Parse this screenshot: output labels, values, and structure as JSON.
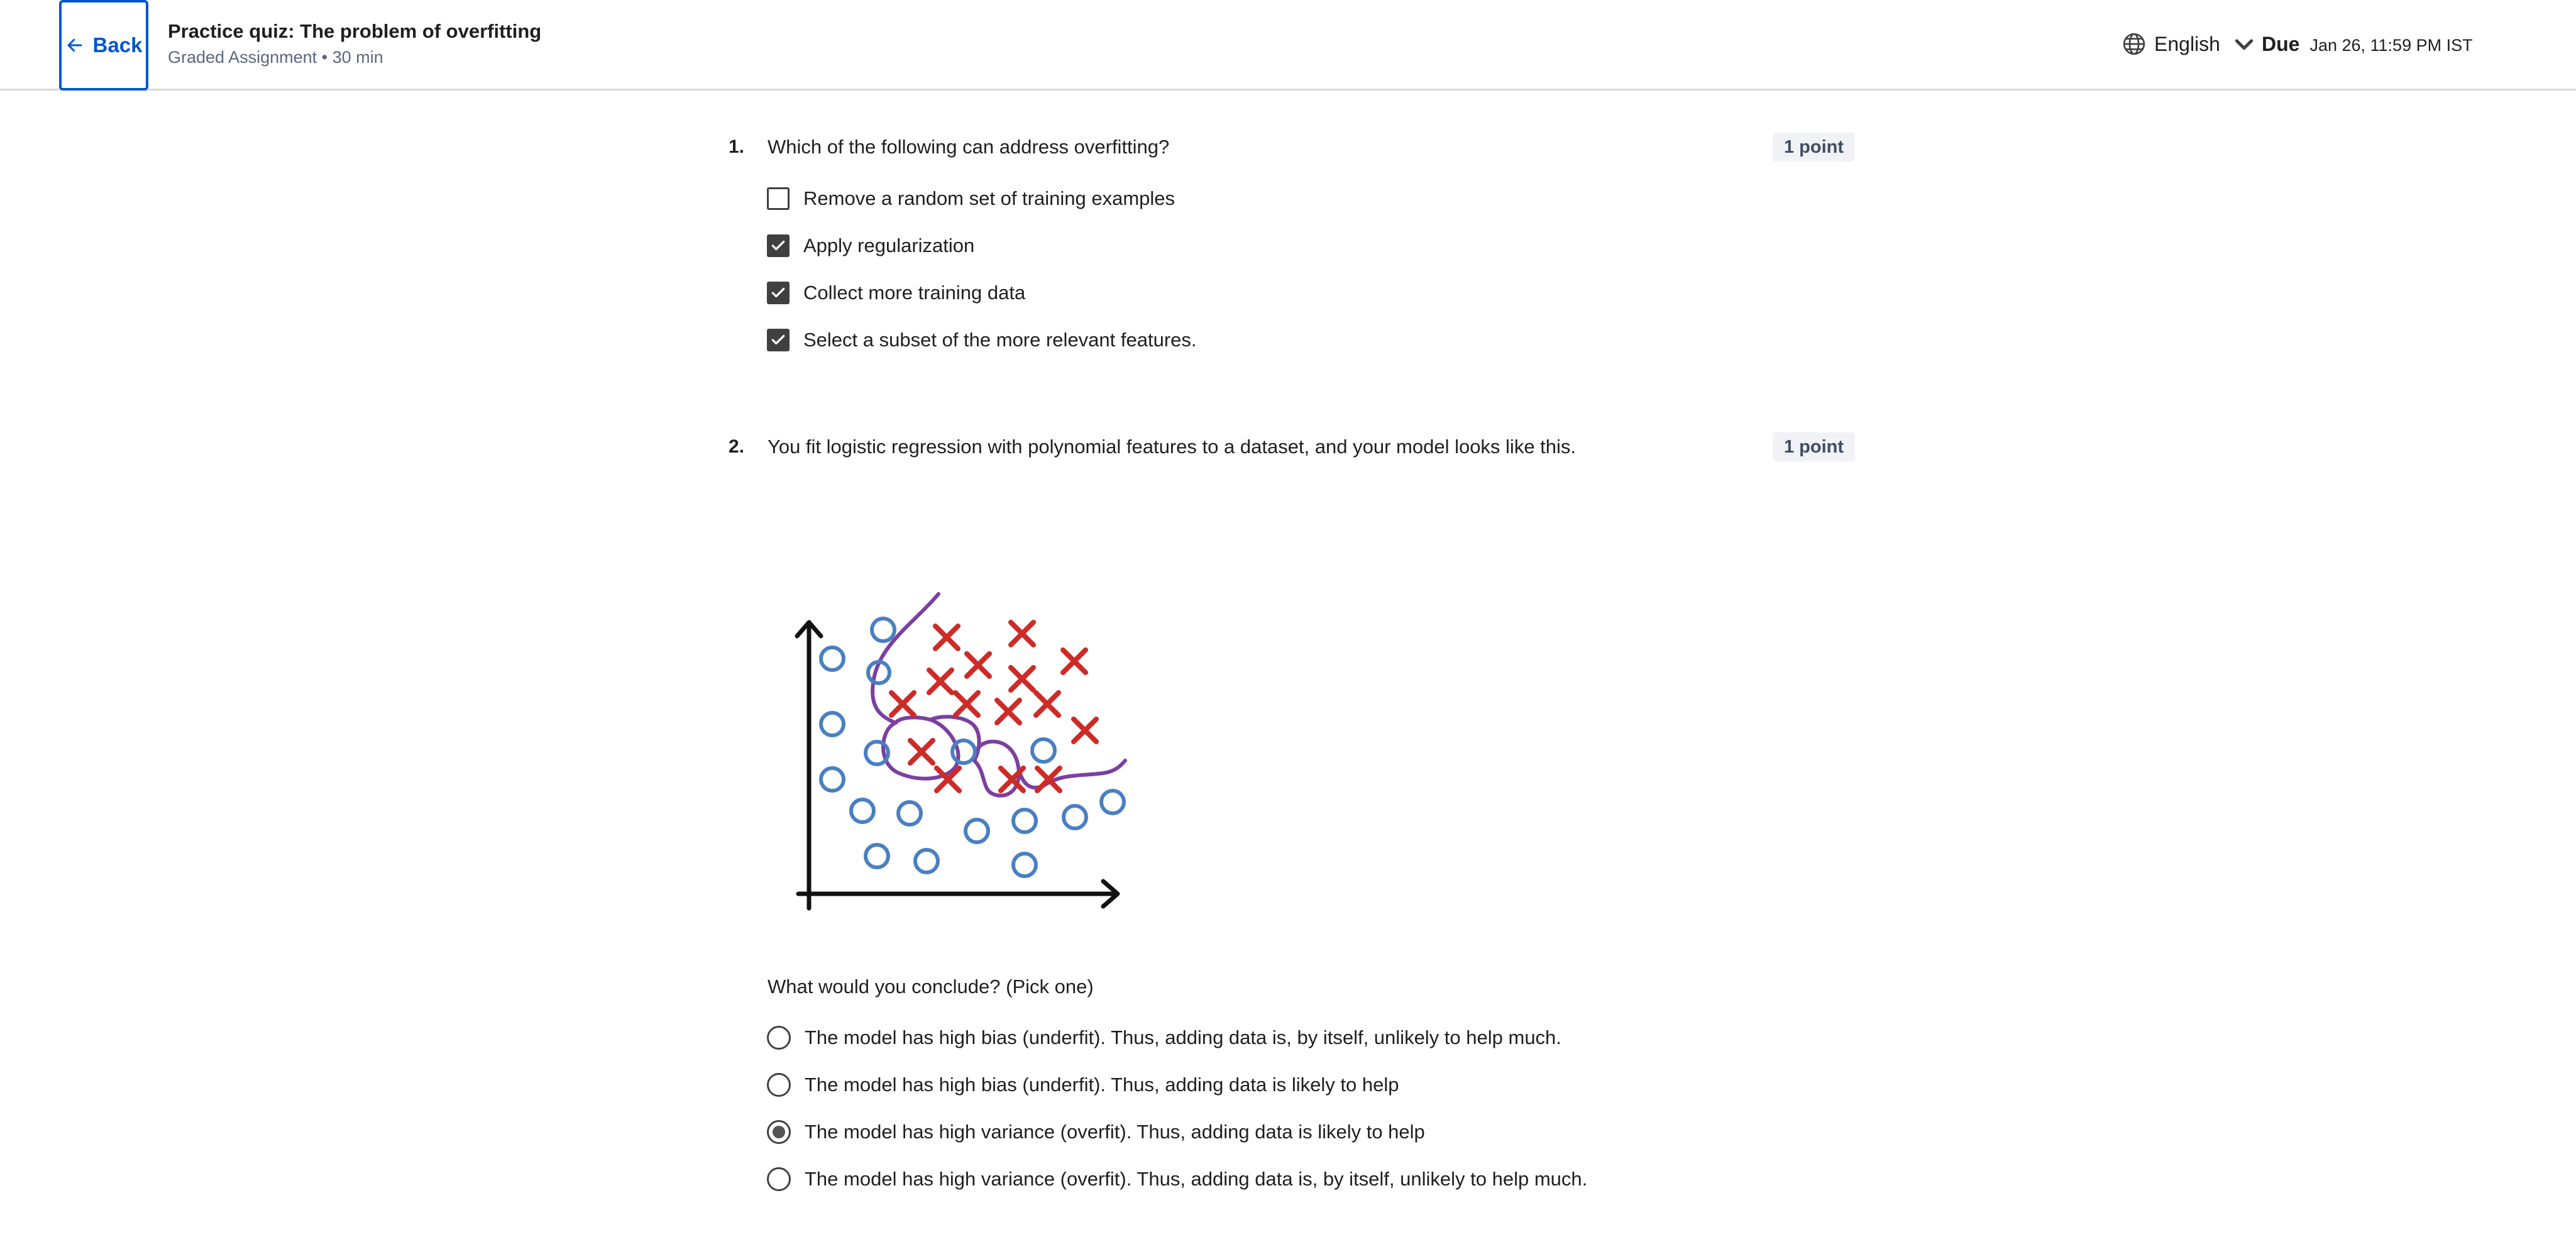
{
  "header": {
    "back_label": "Back",
    "title": "Practice quiz: The problem of overfitting",
    "subtitle": "Graded Assignment • 30 min",
    "language": "English",
    "due_label": "Due",
    "due_value": "Jan 26, 11:59 PM IST"
  },
  "questions": [
    {
      "number": "1.",
      "text": "Which of the following can address overfitting?",
      "points": "1 point",
      "type": "checkbox",
      "options": [
        {
          "label": "Remove a random set of training examples",
          "checked": false
        },
        {
          "label": "Apply regularization",
          "checked": true
        },
        {
          "label": "Collect more training data",
          "checked": true
        },
        {
          "label": "Select a subset of the more relevant features.",
          "checked": true
        }
      ]
    },
    {
      "number": "2.",
      "text": "You fit logistic regression with polynomial features to a dataset, and your model looks like this.",
      "points": "1 point",
      "type": "radio",
      "prompt": "What would you conclude? (Pick one)",
      "options": [
        {
          "label": "The model has high bias (underfit). Thus, adding data is, by itself, unlikely to help much.",
          "selected": false
        },
        {
          "label": "The model has high bias (underfit). Thus, adding data is likely to help",
          "selected": false
        },
        {
          "label": "The model has high variance (overfit). Thus, adding data is likely to help",
          "selected": true
        },
        {
          "label": "The model has high variance (overfit). Thus, adding data is, by itself, unlikely to help much.",
          "selected": false
        }
      ]
    }
  ],
  "colors": {
    "brand_blue": "#0056d2",
    "circle_blue": "#4a7fc1",
    "cross_red": "#cc2b27",
    "boundary_purple": "#7b3fa0"
  },
  "icons": {
    "back": "arrow-left-icon",
    "language": "globe-icon",
    "dropdown": "chevron-down-icon",
    "checked": "check-icon"
  }
}
